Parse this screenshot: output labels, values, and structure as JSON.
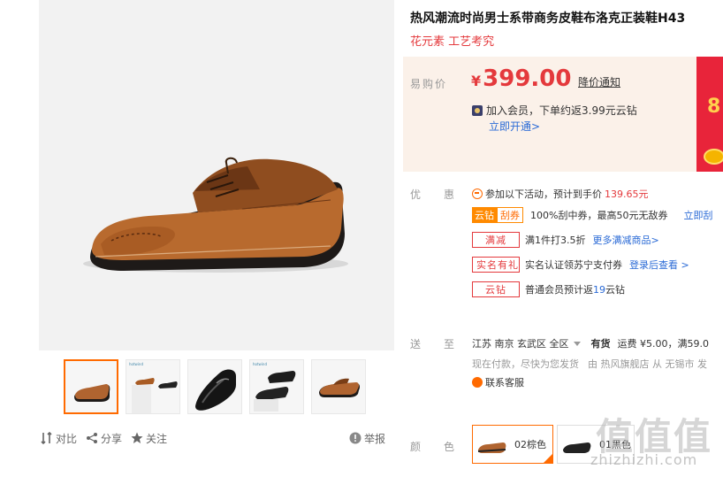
{
  "product": {
    "title": "热风潮流时尚男士系带商务皮鞋布洛克正装鞋H43",
    "subtitle": "花元素 工艺考究"
  },
  "price_panel": {
    "label": "易购价",
    "currency": "¥",
    "amount": "399.00",
    "notify_link": "降价通知",
    "member_text": "加入会员，下单约返3.99元云钻",
    "open_link": "立即开通>",
    "banner_text": "8"
  },
  "promotions": {
    "label_chars": [
      "优",
      "惠"
    ],
    "activity_prefix": "参加以下活动，预计到手价",
    "activity_price": "139.65元",
    "coupon": {
      "tag_left": "云钻",
      "tag_right": "刮券",
      "text": "100%刮中券，最高50元无敌券",
      "link": "立即刮"
    },
    "full_reduction": {
      "tag": "满减",
      "text": "满1件打3.5折",
      "link": "更多满减商品>"
    },
    "gift": {
      "tag": "实名有礼",
      "text": "实名认证领苏宁支付券",
      "link": "登录后查看 >"
    },
    "diamond": {
      "tag": "云钻",
      "text_prefix": "普通会员预计返",
      "value": "19",
      "text_suffix": "云钻"
    }
  },
  "shipping": {
    "label_chars": [
      "送",
      "至"
    ],
    "location": "江苏 南京 玄武区 全区",
    "stock": "有货",
    "fee": "运费 ¥5.00，满59.0",
    "note": "现在付款，尽快为您发货",
    "seller": "由 热风旗舰店 从  无锡市 发",
    "contact": "联系客服"
  },
  "color": {
    "label_chars": [
      "颜",
      "色"
    ],
    "options": [
      {
        "label": "02棕色",
        "selected": true
      },
      {
        "label": "01黑色",
        "selected": false
      }
    ]
  },
  "gallery": {
    "thumb_logo": "hotwind",
    "actions": {
      "compare": "对比",
      "share": "分享",
      "follow": "关注",
      "report": "举报"
    }
  },
  "watermark": {
    "chars": "值值值",
    "url": "zhizhizhi.com"
  },
  "colors": {
    "accent_red": "#e4393c",
    "accent_orange": "#ff6a00",
    "link_blue": "#2a6ad6",
    "price_bg": "#fbf1e9"
  }
}
